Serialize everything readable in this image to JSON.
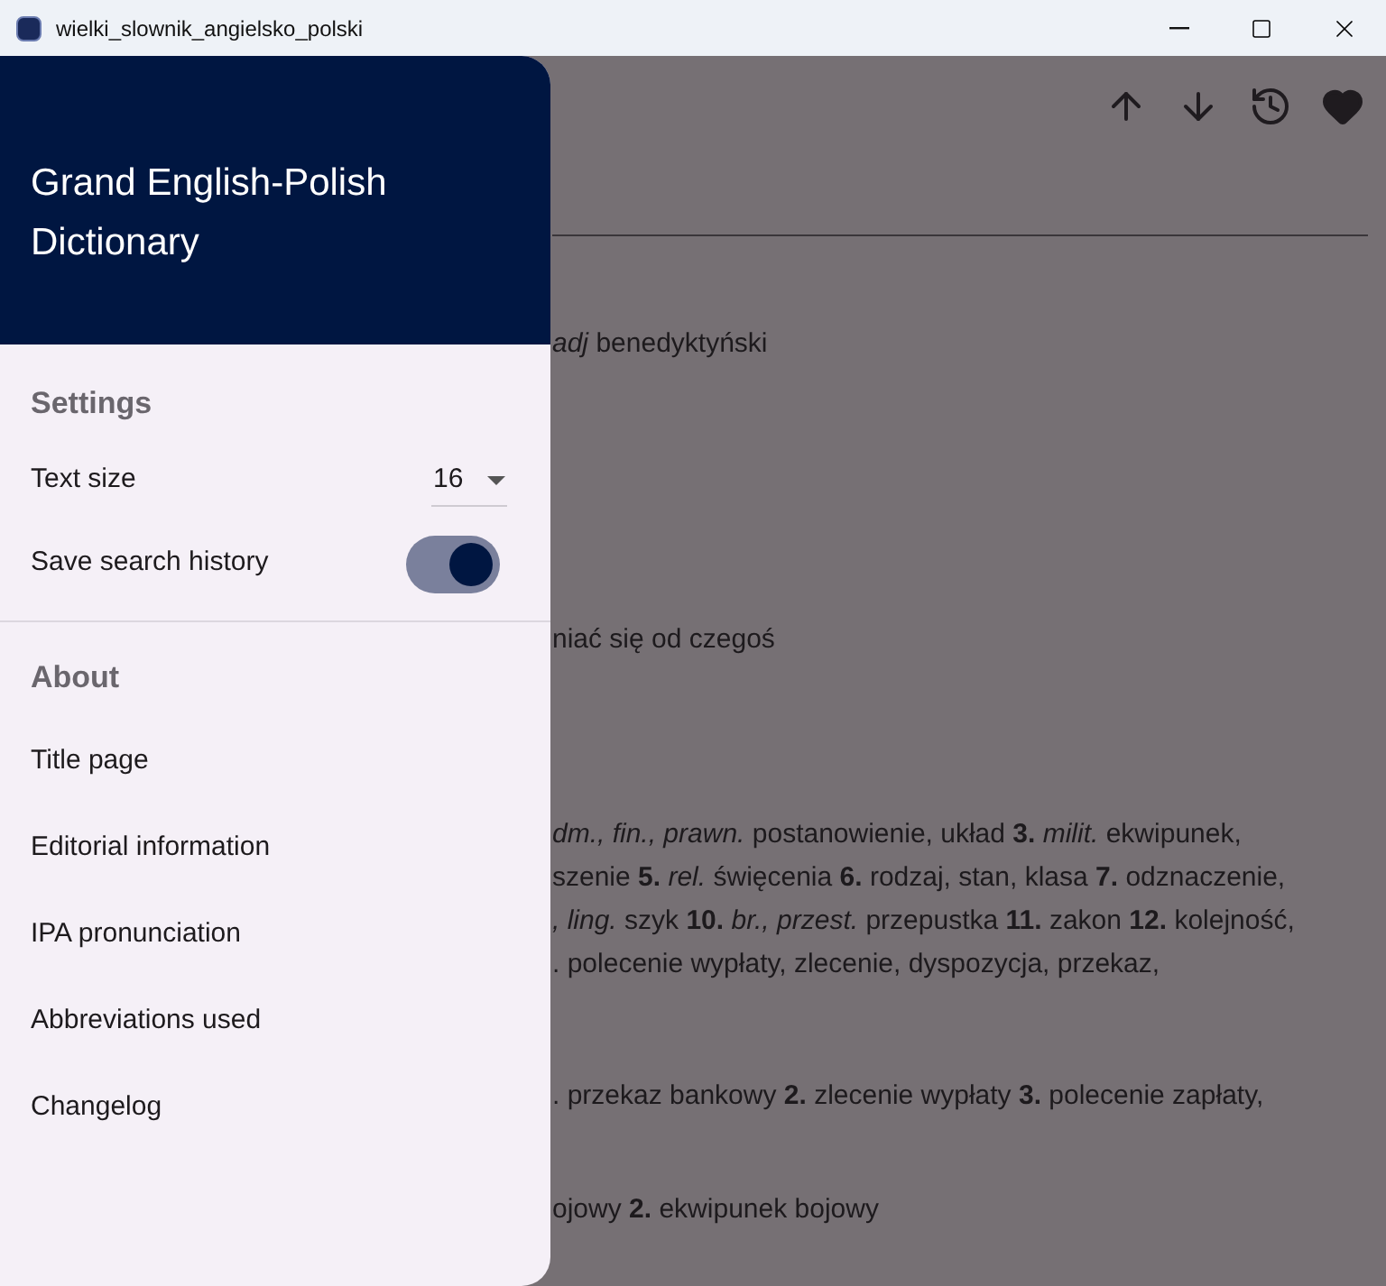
{
  "window": {
    "title": "wielki_slownik_angielsko_polski"
  },
  "drawer": {
    "title": "Grand English-Polish Dictionary",
    "settings": {
      "heading": "Settings",
      "text_size": {
        "label": "Text size",
        "value": "16"
      },
      "save_history": {
        "label": "Save search history",
        "on": true
      }
    },
    "about": {
      "heading": "About",
      "items": [
        "Title page",
        "Editorial information",
        "IPA pronunciation",
        "Abbreviations used",
        "Changelog"
      ]
    }
  },
  "content": {
    "lines": [
      "*adj* benedyktyński",
      "niać się od czegoś",
      "*dm., fin., prawn.* postanowienie, układ **3.** *milit.* ekwipunek,",
      "szenie **5.** *rel.* święcenia **6.** rodzaj, stan, klasa **7.** odznaczenie,",
      "*, ling.* szyk **10.** *br., przest.* przepustka **11.** zakon **12.** kolejność,",
      ". polecenie wypłaty, zlecenie, dyspozycja, przekaz,",
      ". przekaz bankowy **2.** zlecenie wypłaty **3.** polecenie zapłaty,",
      "ojowy **2.** ekwipunek bojowy"
    ]
  }
}
